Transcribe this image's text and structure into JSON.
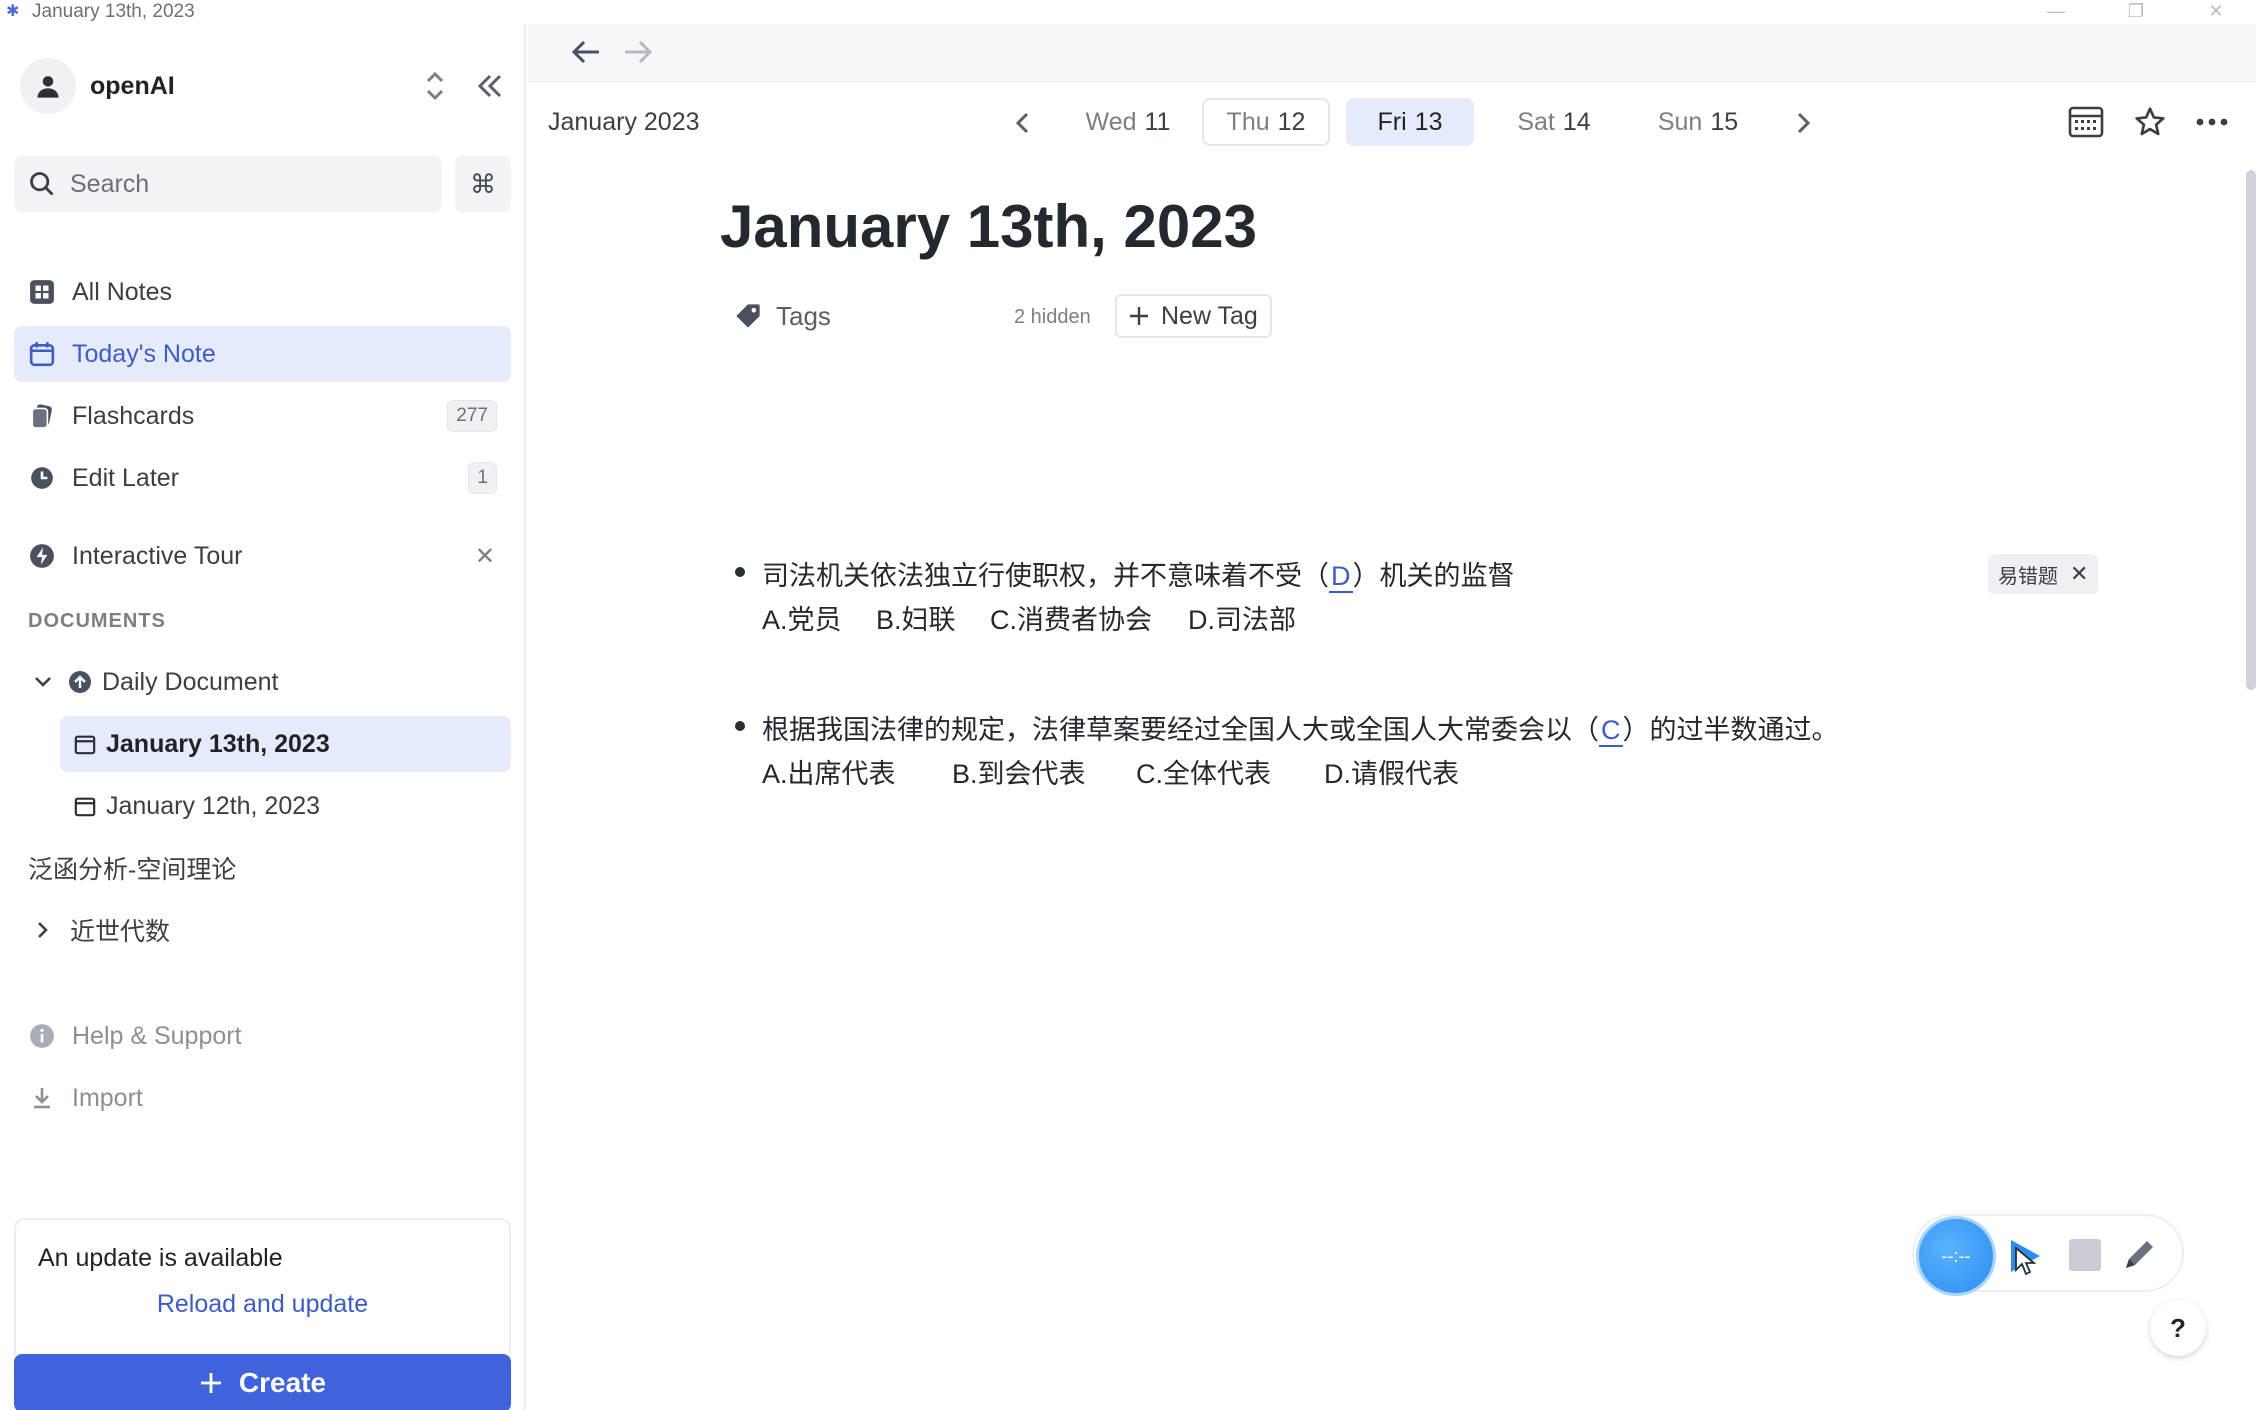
{
  "window": {
    "title": "January 13th, 2023"
  },
  "sidebar": {
    "workspace_name": "openAI",
    "search_placeholder": "Search",
    "command_key": "⌘",
    "nav": [
      {
        "label": "All Notes"
      },
      {
        "label": "Today's Note"
      },
      {
        "label": "Flashcards",
        "badge": "277"
      },
      {
        "label": "Edit Later",
        "badge": "1"
      },
      {
        "label": "Interactive Tour"
      }
    ],
    "section_documents": "DOCUMENTS",
    "tree": {
      "daily_document": "Daily Document",
      "day_1": "January 13th, 2023",
      "day_2": "January 12th, 2023",
      "doc_1": "泛函分析-空间理论",
      "doc_2": "近世代数"
    },
    "help": "Help & Support",
    "import": "Import",
    "update_title": "An update is available",
    "update_link": "Reload and update",
    "create_label": "Create"
  },
  "main": {
    "month": "January 2023",
    "days": [
      {
        "dow": "Wed",
        "num": "11"
      },
      {
        "dow": "Thu",
        "num": "12"
      },
      {
        "dow": "Fri",
        "num": "13"
      },
      {
        "dow": "Sat",
        "num": "14"
      },
      {
        "dow": "Sun",
        "num": "15"
      }
    ],
    "page_title": "January 13th, 2023",
    "tags_label": "Tags",
    "hidden_count": "2 hidden",
    "new_tag_label": "New Tag",
    "q1": {
      "prefix": "司法机关依法独立行使职权，并不意味着不受（",
      "answer": "D",
      "suffix": "）机关的监督",
      "options": [
        "A.党员",
        "B.妇联",
        "C.消费者协会",
        "D.司法部"
      ],
      "tag": "易错题"
    },
    "q2": {
      "prefix": "根据我国法律的规定，法律草案要经过全国人大或全国人大常委会以（",
      "answer": "C",
      "suffix": "）的过半数通过。",
      "options": [
        "A.出席代表",
        "B.到会代表",
        "C.全体代表",
        "D.请假代表"
      ]
    },
    "recorder_time": "--:--",
    "help_label": "?"
  }
}
